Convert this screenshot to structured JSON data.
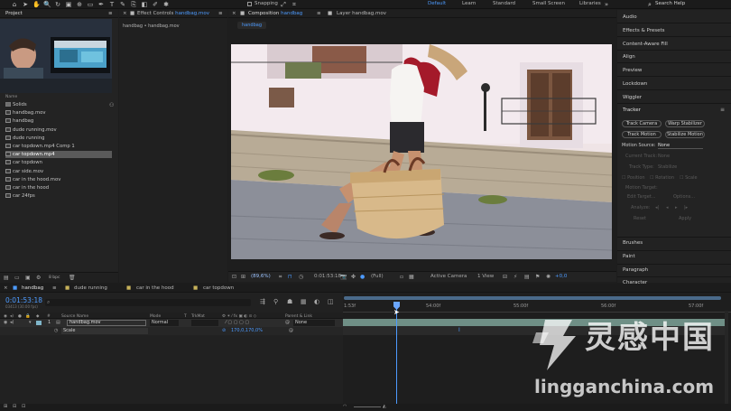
{
  "toolbar": {
    "snapping": "Snapping",
    "workspaces": [
      "Default",
      "Learn",
      "Standard",
      "Small Screen",
      "Libraries"
    ],
    "search": "Search Help"
  },
  "project": {
    "tab": "Project",
    "name_col": "Name",
    "items": [
      "Solids",
      "handbag.mov",
      "handbag",
      "dude running.mov",
      "dude running",
      "car topdown.mp4 Comp 1",
      "car topdown.mp4",
      "car topdown",
      "car side.mov",
      "car in the hood.mov",
      "car in the hood",
      "car 24fps"
    ],
    "selected_index": 6,
    "bpc": "8 bpc"
  },
  "effect_controls": {
    "tab_prefix": "Effect Controls",
    "tab_file": "handbag.mov",
    "subtitle": "handbag • handbag.mov"
  },
  "composition": {
    "tab_prefix": "Composition",
    "tab_name": "handbag",
    "layer_tab": "Layer handbag.mov",
    "comp_button": "handbag",
    "zoom": "(89,6%)",
    "timecode": "0:01:53:18",
    "resolution": "(Full)",
    "camera": "Active Camera",
    "view": "1 View",
    "exposure": "+0,0"
  },
  "right_panel": {
    "items": [
      "Audio",
      "Effects & Presets",
      "Content-Aware Fill",
      "Align",
      "Preview",
      "Lockdown",
      "Wiggler"
    ],
    "tracker": {
      "title": "Tracker",
      "buttons": [
        "Track Camera",
        "Warp Stabilizer",
        "Track Motion",
        "Stabilize Motion"
      ],
      "motion_source_label": "Motion Source:",
      "motion_source_value": "None",
      "current_track_label": "Current Track:",
      "current_track_value": "None",
      "track_type_label": "Track Type:",
      "track_type_value": "Stabilize",
      "checks": [
        "Position",
        "Rotation",
        "Scale"
      ],
      "motion_target": "Motion Target:",
      "edit_target": "Edit Target...",
      "options": "Options...",
      "analyze": "Analyze:",
      "reset": "Reset",
      "apply": "Apply"
    },
    "bottom_items": [
      "Brushes",
      "Paint",
      "Paragraph",
      "Character"
    ]
  },
  "timeline": {
    "tabs": [
      "handbag",
      "dude running",
      "car in the hood",
      "car topdown"
    ],
    "timecode": "0:01:53:18",
    "frame_info": "03413 (30.00 fps)",
    "columns": [
      "Source Name",
      "Mode",
      "T",
      "TrkMat",
      "Parent & Link"
    ],
    "layer_number": "1",
    "layer_name": "handbag.mov",
    "layer_mode": "Normal",
    "parent_value": "None",
    "property_name": "Scale",
    "property_value": "170,0,170,0%",
    "ruler_labels": [
      "1:53f",
      "54:00f",
      "55:00f",
      "56:00f",
      "57:00f"
    ]
  },
  "watermark": {
    "cn": "灵感中国",
    "url": "lingganchina.com"
  }
}
